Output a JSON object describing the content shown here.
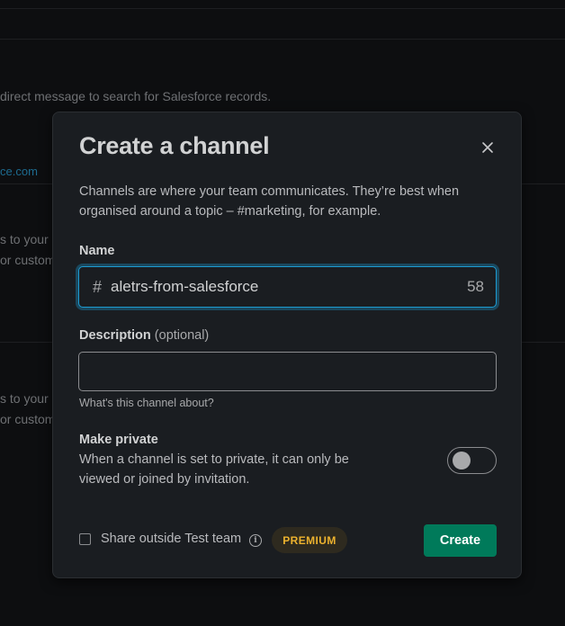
{
  "background": {
    "line1": "direct message to search for Salesforce records.",
    "link": "ce.com",
    "frag_a1": "s to your",
    "frag_a2": "or custom",
    "frag_b1": "s to your",
    "frag_b2": "or custom"
  },
  "modal": {
    "title": "Create a channel",
    "close_icon": "close-icon",
    "intro": "Channels are where your team communicates. They’re best when organised around a topic – #marketing, for example.",
    "name": {
      "label": "Name",
      "prefix": "#",
      "value": "aletrs-from-salesforce",
      "remaining_chars": "58"
    },
    "description": {
      "label": "Description",
      "optional": "(optional)",
      "value": "",
      "hint": "What's this channel about?"
    },
    "private": {
      "label": "Make private",
      "description": "When a channel is set to private, it can only be viewed or joined by invitation.",
      "enabled": false
    },
    "share": {
      "label": "Share outside Test team",
      "checked": false,
      "info_icon": "info-icon",
      "badge": "PREMIUM"
    },
    "create_label": "Create"
  },
  "colors": {
    "accent": "#1d9bd1",
    "primary_button": "#007a5a",
    "premium": "#ecb22e"
  }
}
